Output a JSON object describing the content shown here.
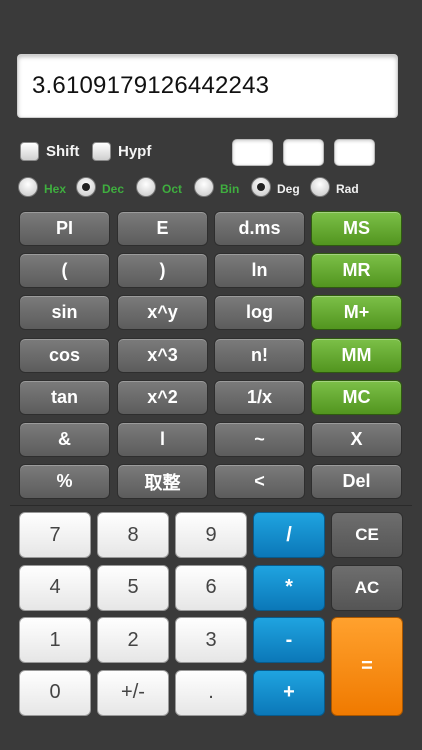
{
  "display": {
    "value": "3.6109179126442243"
  },
  "toggles": {
    "shift": "Shift",
    "hypf": "Hypf"
  },
  "memory_slots": [
    "",
    "",
    ""
  ],
  "modes": [
    {
      "label": "Hex",
      "selected": false,
      "color": "green"
    },
    {
      "label": "Dec",
      "selected": true,
      "color": "green"
    },
    {
      "label": "Oct",
      "selected": false,
      "color": "green"
    },
    {
      "label": "Bin",
      "selected": false,
      "color": "green"
    },
    {
      "label": "Deg",
      "selected": true,
      "color": "white"
    },
    {
      "label": "Rad",
      "selected": false,
      "color": "white"
    }
  ],
  "sci_keys": [
    [
      "PI",
      "E",
      "d.ms",
      "MS"
    ],
    [
      "(",
      ")",
      "ln",
      "MR"
    ],
    [
      "sin",
      "x^y",
      "log",
      "M+"
    ],
    [
      "cos",
      "x^3",
      "n!",
      "MM"
    ],
    [
      "tan",
      "x^2",
      "1/x",
      "MC"
    ],
    [
      "&",
      "l",
      "~",
      "X"
    ],
    [
      "%",
      "取整",
      "<",
      "Del"
    ]
  ],
  "num_keys": [
    [
      "7",
      "8",
      "9",
      "/",
      "CE"
    ],
    [
      "4",
      "5",
      "6",
      "*",
      "AC"
    ],
    [
      "1",
      "2",
      "3",
      "-",
      "="
    ],
    [
      "0",
      "+/-",
      ".",
      "+",
      ""
    ]
  ],
  "colors": {
    "background": "#3a3a3a",
    "memory_green": "#5ea82a",
    "operator_blue": "#1490d0",
    "equals_orange": "#f7901a",
    "mode_green": "#3fae3f"
  }
}
